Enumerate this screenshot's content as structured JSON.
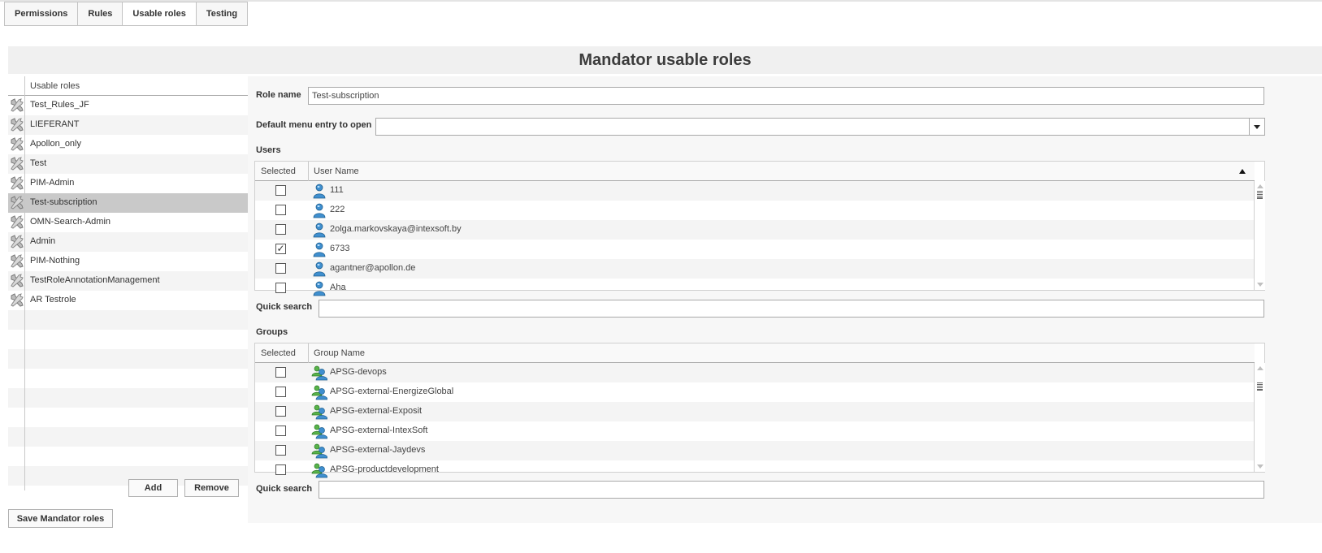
{
  "tabs": [
    {
      "label": "Permissions"
    },
    {
      "label": "Rules"
    },
    {
      "label": "Usable roles"
    },
    {
      "label": "Testing"
    }
  ],
  "page_title": "Mandator usable roles",
  "roles": {
    "header": "Usable roles",
    "items": [
      {
        "label": "Test_Rules_JF"
      },
      {
        "label": "LIEFERANT"
      },
      {
        "label": "Apollon_only"
      },
      {
        "label": "Test"
      },
      {
        "label": "PIM-Admin"
      },
      {
        "label": "Test-subscription",
        "selected": true
      },
      {
        "label": "OMN-Search-Admin"
      },
      {
        "label": "Admin"
      },
      {
        "label": "PIM-Nothing"
      },
      {
        "label": "TestRoleAnnotationManagement"
      },
      {
        "label": "AR Testrole"
      }
    ],
    "add_label": "Add",
    "remove_label": "Remove"
  },
  "form": {
    "role_name_label": "Role name",
    "role_name_value": "Test-subscription",
    "default_menu_label": "Default menu entry to open",
    "default_menu_value": "",
    "users_label": "Users",
    "users_columns": {
      "selected": "Selected",
      "name": "User Name"
    },
    "users": [
      {
        "name": "111",
        "checked": false
      },
      {
        "name": "222",
        "checked": false
      },
      {
        "name": "2olga.markovskaya@intexsoft.by",
        "checked": false
      },
      {
        "name": "6733",
        "checked": true
      },
      {
        "name": "agantner@apollon.de",
        "checked": false
      },
      {
        "name": "Aha",
        "checked": false
      }
    ],
    "quick_search_label": "Quick search",
    "groups_label": "Groups",
    "groups_columns": {
      "selected": "Selected",
      "name": "Group Name"
    },
    "groups": [
      {
        "name": "APSG-devops",
        "checked": false
      },
      {
        "name": "APSG-external-EnergizeGlobal",
        "checked": false
      },
      {
        "name": "APSG-external-Exposit",
        "checked": false
      },
      {
        "name": "APSG-external-IntexSoft",
        "checked": false
      },
      {
        "name": "APSG-external-Jaydevs",
        "checked": false
      },
      {
        "name": "APSG-productdevelopment",
        "checked": false
      }
    ],
    "quick_search_label_2": "Quick search"
  },
  "save_label": "Save Mandator roles",
  "icons": {
    "role": "wrench-icon",
    "user": "user-icon",
    "group": "group-icon"
  }
}
